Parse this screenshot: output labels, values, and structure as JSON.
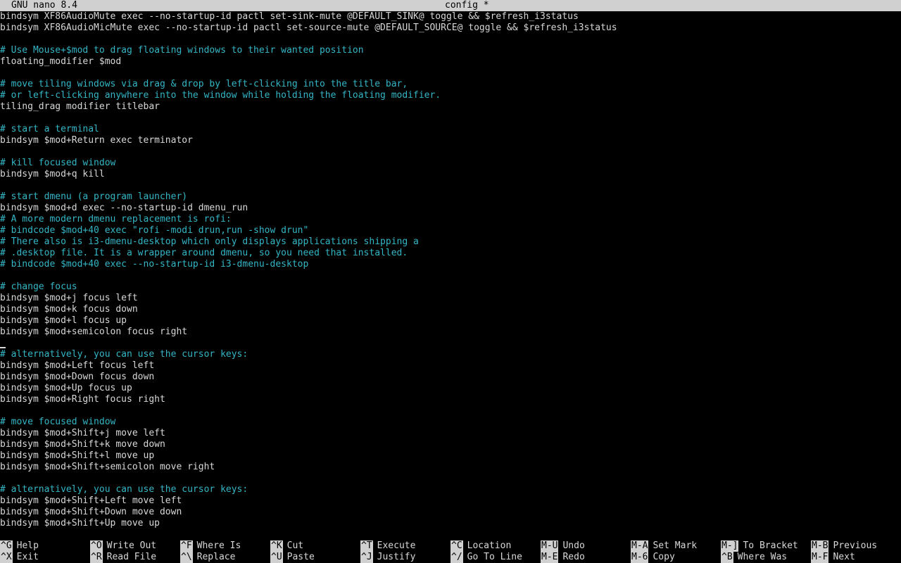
{
  "titlebar": {
    "app": "GNU nano 8.4",
    "file": "config *"
  },
  "lines": [
    {
      "text": "bindsym XF86AudioMute exec --no-startup-id pactl set-sink-mute @DEFAULT_SINK@ toggle && $refresh_i3status",
      "type": "code"
    },
    {
      "text": "bindsym XF86AudioMicMute exec --no-startup-id pactl set-source-mute @DEFAULT_SOURCE@ toggle && $refresh_i3status",
      "type": "code"
    },
    {
      "text": "",
      "type": "code"
    },
    {
      "text": "# Use Mouse+$mod to drag floating windows to their wanted position",
      "type": "comment"
    },
    {
      "text": "floating_modifier $mod",
      "type": "code"
    },
    {
      "text": "",
      "type": "code"
    },
    {
      "text": "# move tiling windows via drag & drop by left-clicking into the title bar,",
      "type": "comment"
    },
    {
      "text": "# or left-clicking anywhere into the window while holding the floating modifier.",
      "type": "comment"
    },
    {
      "text": "tiling_drag modifier titlebar",
      "type": "code"
    },
    {
      "text": "",
      "type": "code"
    },
    {
      "text": "# start a terminal",
      "type": "comment"
    },
    {
      "text": "bindsym $mod+Return exec terminator",
      "type": "code"
    },
    {
      "text": "",
      "type": "code"
    },
    {
      "text": "# kill focused window",
      "type": "comment"
    },
    {
      "text": "bindsym $mod+q kill",
      "type": "code"
    },
    {
      "text": "",
      "type": "code"
    },
    {
      "text": "# start dmenu (a program launcher)",
      "type": "comment"
    },
    {
      "text": "bindsym $mod+d exec --no-startup-id dmenu_run",
      "type": "code"
    },
    {
      "text": "# A more modern dmenu replacement is rofi:",
      "type": "comment"
    },
    {
      "text": "# bindcode $mod+40 exec \"rofi -modi drun,run -show drun\"",
      "type": "comment"
    },
    {
      "text": "# There also is i3-dmenu-desktop which only displays applications shipping a",
      "type": "comment"
    },
    {
      "text": "# .desktop file. It is a wrapper around dmenu, so you need that installed.",
      "type": "comment"
    },
    {
      "text": "# bindcode $mod+40 exec --no-startup-id i3-dmenu-desktop",
      "type": "comment"
    },
    {
      "text": "",
      "type": "code"
    },
    {
      "text": "# change focus",
      "type": "comment"
    },
    {
      "text": "bindsym $mod+j focus left",
      "type": "code"
    },
    {
      "text": "bindsym $mod+k focus down",
      "type": "code"
    },
    {
      "text": "bindsym $mod+l focus up",
      "type": "code"
    },
    {
      "text": "bindsym $mod+semicolon focus right",
      "type": "code"
    },
    {
      "text": "",
      "type": "cursor"
    },
    {
      "text": "# alternatively, you can use the cursor keys:",
      "type": "comment"
    },
    {
      "text": "bindsym $mod+Left focus left",
      "type": "code"
    },
    {
      "text": "bindsym $mod+Down focus down",
      "type": "code"
    },
    {
      "text": "bindsym $mod+Up focus up",
      "type": "code"
    },
    {
      "text": "bindsym $mod+Right focus right",
      "type": "code"
    },
    {
      "text": "",
      "type": "code"
    },
    {
      "text": "# move focused window",
      "type": "comment"
    },
    {
      "text": "bindsym $mod+Shift+j move left",
      "type": "code"
    },
    {
      "text": "bindsym $mod+Shift+k move down",
      "type": "code"
    },
    {
      "text": "bindsym $mod+Shift+l move up",
      "type": "code"
    },
    {
      "text": "bindsym $mod+Shift+semicolon move right",
      "type": "code"
    },
    {
      "text": "",
      "type": "code"
    },
    {
      "text": "# alternatively, you can use the cursor keys:",
      "type": "comment"
    },
    {
      "text": "bindsym $mod+Shift+Left move left",
      "type": "code"
    },
    {
      "text": "bindsym $mod+Shift+Down move down",
      "type": "code"
    },
    {
      "text": "bindsym $mod+Shift+Up move up",
      "type": "code"
    }
  ],
  "shortcuts": [
    {
      "key": "^G",
      "label": "Help"
    },
    {
      "key": "^X",
      "label": "Exit"
    },
    {
      "key": "^O",
      "label": "Write Out"
    },
    {
      "key": "^R",
      "label": "Read File"
    },
    {
      "key": "^F",
      "label": "Where Is"
    },
    {
      "key": "^\\",
      "label": "Replace"
    },
    {
      "key": "^K",
      "label": "Cut"
    },
    {
      "key": "^U",
      "label": "Paste"
    },
    {
      "key": "^T",
      "label": "Execute"
    },
    {
      "key": "^J",
      "label": "Justify"
    },
    {
      "key": "^C",
      "label": "Location"
    },
    {
      "key": "^/",
      "label": "Go To Line"
    },
    {
      "key": "M-U",
      "label": "Undo"
    },
    {
      "key": "M-E",
      "label": "Redo"
    },
    {
      "key": "M-A",
      "label": "Set Mark"
    },
    {
      "key": "M-6",
      "label": "Copy"
    },
    {
      "key": "M-]",
      "label": "To Bracket"
    },
    {
      "key": "^B",
      "label": "Where Was"
    },
    {
      "key": "M-B",
      "label": "Previous"
    },
    {
      "key": "M-F",
      "label": "Next"
    }
  ],
  "colors": {
    "comment": "#33b6c6",
    "text": "#d8d8d8",
    "bar": "#d0d0d0",
    "background": "#000000"
  }
}
